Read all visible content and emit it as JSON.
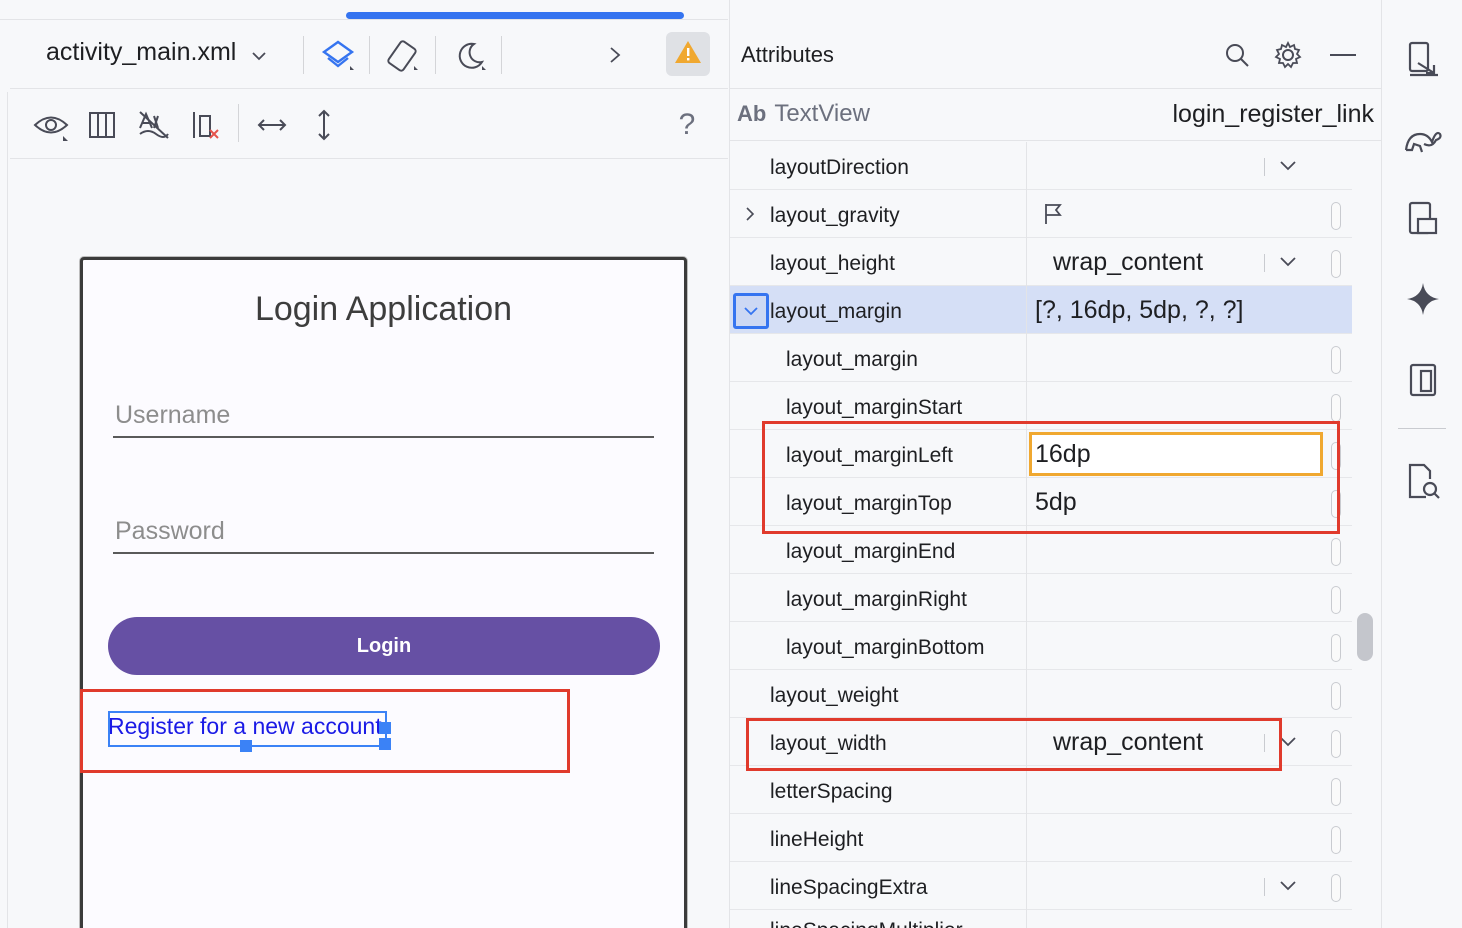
{
  "editor": {
    "file_name": "activity_main.xml",
    "toolbar_icons": [
      "design-surface-icon",
      "orientation-icon",
      "night-mode-icon",
      "more-chevron-icon",
      "warning-icon"
    ],
    "view_toolbar_icons": [
      "view-options-icon",
      "blueprint-icon",
      "constraint-autoconnect-off-icon",
      "clear-constraints-icon",
      "expand-horizontal-icon",
      "expand-vertical-icon",
      "help-icon"
    ],
    "help_label": "?"
  },
  "preview": {
    "app_title": "Login Application",
    "username_placeholder": "Username",
    "password_placeholder": "Password",
    "login_button": "Login",
    "register_link": "Register for a new account"
  },
  "attributes": {
    "panel_title": "Attributes",
    "component_type_badge": "Ab",
    "component_type": "TextView",
    "component_id": "login_register_link",
    "rows": [
      {
        "name": "layoutDirection",
        "value": "",
        "dropdown": true
      },
      {
        "name": "layout_gravity",
        "value": "",
        "flag": true
      },
      {
        "name": "layout_height",
        "value": "wrap_content",
        "dropdown": true
      },
      {
        "name": "layout_margin",
        "value": "[?, 16dp, 5dp, ?, ?]",
        "expanded": true
      },
      {
        "name": "layout_margin",
        "value": ""
      },
      {
        "name": "layout_marginStart",
        "value": ""
      },
      {
        "name": "layout_marginLeft",
        "value": "16dp"
      },
      {
        "name": "layout_marginTop",
        "value": "5dp"
      },
      {
        "name": "layout_marginEnd",
        "value": ""
      },
      {
        "name": "layout_marginRight",
        "value": ""
      },
      {
        "name": "layout_marginBottom",
        "value": ""
      },
      {
        "name": "layout_weight",
        "value": ""
      },
      {
        "name": "layout_width",
        "value": "wrap_content",
        "dropdown": true
      },
      {
        "name": "letterSpacing",
        "value": ""
      },
      {
        "name": "lineHeight",
        "value": ""
      },
      {
        "name": "lineSpacingExtra",
        "value": "",
        "dropdown": true
      },
      {
        "name": "lineSpacingMultiplier",
        "value": ""
      }
    ]
  },
  "tool_strip": [
    "running-devices-icon",
    "gradle-icon",
    "device-manager-icon",
    "gemini-icon",
    "device-explorer-icon",
    "app-inspection-icon"
  ],
  "colors": {
    "accent": "#3574f0",
    "login_button": "#6650a4",
    "link": "#1a1ae6",
    "highlight_box": "#e03a2c",
    "focus_input": "#f0a830",
    "selected_row": "#d5dff6"
  }
}
